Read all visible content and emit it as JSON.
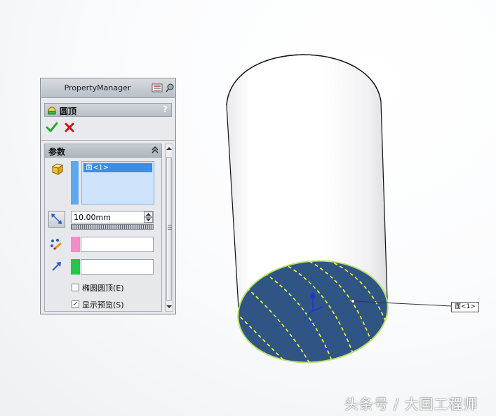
{
  "panel": {
    "title": "PropertyManager",
    "feature_title": "圆顶",
    "help_label": "?",
    "group_title": "参数",
    "selection_item": "面<1>",
    "distance_value": "10.00mm",
    "elliptical_label": "椭圆圆顶(E)",
    "elliptical_checked": false,
    "preview_label": "显示预览(S)",
    "preview_checked": true,
    "preview_mark": "✓"
  },
  "viewport": {
    "callout_label": "面<1>",
    "face_color": "#2f5585",
    "body_color": "#ffffff",
    "preview_curve_color": "#ffff33"
  },
  "colors": {
    "selection_strip": "#5fa8f0",
    "pink_strip": "#f48cc8",
    "green_strip": "#22c64a",
    "ok_check": "#2aa82a",
    "cancel_x": "#d01010"
  },
  "icons": [
    "check-icon",
    "x-icon",
    "dome-icon",
    "face-select-icon",
    "distance-icon",
    "constraint-point-icon",
    "direction-arrow-icon",
    "collapse-icon",
    "pushpin-icon"
  ],
  "watermark": "头条号 / 大国工程师"
}
